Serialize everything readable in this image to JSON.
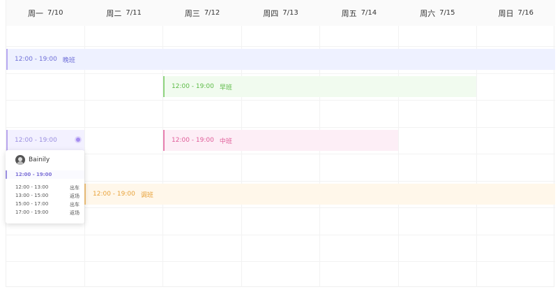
{
  "days": [
    {
      "name": "周一",
      "date": "7/10"
    },
    {
      "name": "周二",
      "date": "7/11"
    },
    {
      "name": "周三",
      "date": "7/12"
    },
    {
      "name": "周四",
      "date": "7/13"
    },
    {
      "name": "周五",
      "date": "7/14"
    },
    {
      "name": "周六",
      "date": "7/15"
    },
    {
      "name": "周日",
      "date": "7/16"
    }
  ],
  "shifts": {
    "wan": {
      "time": "12:00 - 19:00",
      "label": "晚班",
      "color": "#6f6fd8"
    },
    "zao": {
      "time": "12:00 - 19:00",
      "label": "早班",
      "color": "#5cbb46"
    },
    "zhong": {
      "time": "12:00 - 19:00",
      "label": "中班",
      "color": "#e05d99"
    },
    "tiao": {
      "time": "12:00 - 19:00",
      "label": "调班",
      "color": "#e8a23a"
    },
    "selected": {
      "time": "12:00 - 19:00",
      "color": "#9b8fe0"
    }
  },
  "popup": {
    "user": "Bainily",
    "time": "12:00 - 19:00",
    "rows": [
      {
        "time": "12:00 - 13:00",
        "status": "出车"
      },
      {
        "time": "13:00 - 15:00",
        "status": "返场"
      },
      {
        "time": "15:00 - 17:00",
        "status": "出车"
      },
      {
        "time": "17:00 - 19:00",
        "status": "返场"
      }
    ]
  }
}
